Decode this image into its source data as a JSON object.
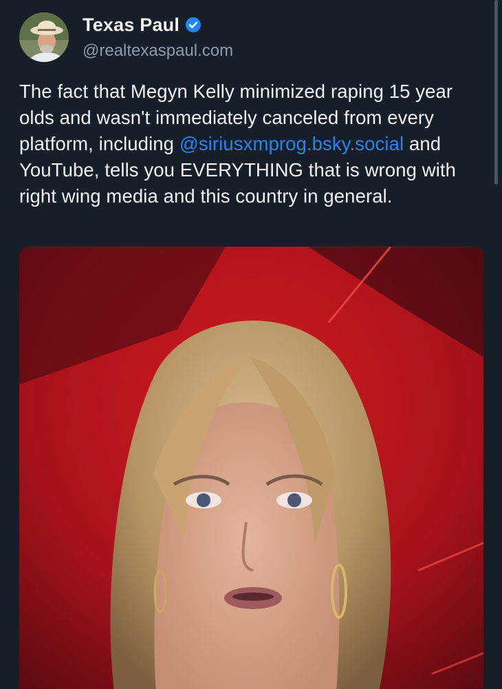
{
  "author": {
    "display_name": "Texas Paul",
    "handle": "@realtexaspaul.com",
    "verified_icon": "verified-checkmark-icon",
    "avatar_icon": "user-avatar"
  },
  "post": {
    "text_before_mention": "The fact that Megyn Kelly minimized raping 15 year olds and wasn't immediately canceled from every platform, including ",
    "mention": "@siriusxmprog.bsky.social",
    "text_after_mention": " and YouTube, tells you EVERYTHING that is wrong with right wing media and this country in general."
  },
  "media": {
    "type": "image"
  },
  "colors": {
    "background": "#161e27",
    "text": "#f1f3f5",
    "secondary_text": "#8d9aa8",
    "link": "#1f86f5",
    "verified": "#1f86f5"
  }
}
